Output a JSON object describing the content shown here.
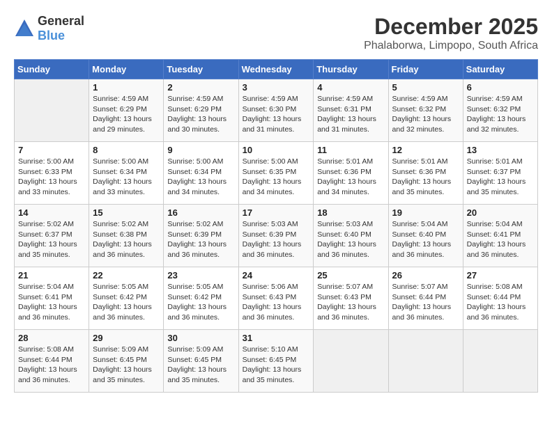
{
  "header": {
    "logo_general": "General",
    "logo_blue": "Blue",
    "month": "December 2025",
    "location": "Phalaborwa, Limpopo, South Africa"
  },
  "days_of_week": [
    "Sunday",
    "Monday",
    "Tuesday",
    "Wednesday",
    "Thursday",
    "Friday",
    "Saturday"
  ],
  "weeks": [
    [
      {
        "day": "",
        "info": ""
      },
      {
        "day": "1",
        "info": "Sunrise: 4:59 AM\nSunset: 6:29 PM\nDaylight: 13 hours\nand 29 minutes."
      },
      {
        "day": "2",
        "info": "Sunrise: 4:59 AM\nSunset: 6:29 PM\nDaylight: 13 hours\nand 30 minutes."
      },
      {
        "day": "3",
        "info": "Sunrise: 4:59 AM\nSunset: 6:30 PM\nDaylight: 13 hours\nand 31 minutes."
      },
      {
        "day": "4",
        "info": "Sunrise: 4:59 AM\nSunset: 6:31 PM\nDaylight: 13 hours\nand 31 minutes."
      },
      {
        "day": "5",
        "info": "Sunrise: 4:59 AM\nSunset: 6:32 PM\nDaylight: 13 hours\nand 32 minutes."
      },
      {
        "day": "6",
        "info": "Sunrise: 4:59 AM\nSunset: 6:32 PM\nDaylight: 13 hours\nand 32 minutes."
      }
    ],
    [
      {
        "day": "7",
        "info": "Sunrise: 5:00 AM\nSunset: 6:33 PM\nDaylight: 13 hours\nand 33 minutes."
      },
      {
        "day": "8",
        "info": "Sunrise: 5:00 AM\nSunset: 6:34 PM\nDaylight: 13 hours\nand 33 minutes."
      },
      {
        "day": "9",
        "info": "Sunrise: 5:00 AM\nSunset: 6:34 PM\nDaylight: 13 hours\nand 34 minutes."
      },
      {
        "day": "10",
        "info": "Sunrise: 5:00 AM\nSunset: 6:35 PM\nDaylight: 13 hours\nand 34 minutes."
      },
      {
        "day": "11",
        "info": "Sunrise: 5:01 AM\nSunset: 6:36 PM\nDaylight: 13 hours\nand 34 minutes."
      },
      {
        "day": "12",
        "info": "Sunrise: 5:01 AM\nSunset: 6:36 PM\nDaylight: 13 hours\nand 35 minutes."
      },
      {
        "day": "13",
        "info": "Sunrise: 5:01 AM\nSunset: 6:37 PM\nDaylight: 13 hours\nand 35 minutes."
      }
    ],
    [
      {
        "day": "14",
        "info": "Sunrise: 5:02 AM\nSunset: 6:37 PM\nDaylight: 13 hours\nand 35 minutes."
      },
      {
        "day": "15",
        "info": "Sunrise: 5:02 AM\nSunset: 6:38 PM\nDaylight: 13 hours\nand 36 minutes."
      },
      {
        "day": "16",
        "info": "Sunrise: 5:02 AM\nSunset: 6:39 PM\nDaylight: 13 hours\nand 36 minutes."
      },
      {
        "day": "17",
        "info": "Sunrise: 5:03 AM\nSunset: 6:39 PM\nDaylight: 13 hours\nand 36 minutes."
      },
      {
        "day": "18",
        "info": "Sunrise: 5:03 AM\nSunset: 6:40 PM\nDaylight: 13 hours\nand 36 minutes."
      },
      {
        "day": "19",
        "info": "Sunrise: 5:04 AM\nSunset: 6:40 PM\nDaylight: 13 hours\nand 36 minutes."
      },
      {
        "day": "20",
        "info": "Sunrise: 5:04 AM\nSunset: 6:41 PM\nDaylight: 13 hours\nand 36 minutes."
      }
    ],
    [
      {
        "day": "21",
        "info": "Sunrise: 5:04 AM\nSunset: 6:41 PM\nDaylight: 13 hours\nand 36 minutes."
      },
      {
        "day": "22",
        "info": "Sunrise: 5:05 AM\nSunset: 6:42 PM\nDaylight: 13 hours\nand 36 minutes."
      },
      {
        "day": "23",
        "info": "Sunrise: 5:05 AM\nSunset: 6:42 PM\nDaylight: 13 hours\nand 36 minutes."
      },
      {
        "day": "24",
        "info": "Sunrise: 5:06 AM\nSunset: 6:43 PM\nDaylight: 13 hours\nand 36 minutes."
      },
      {
        "day": "25",
        "info": "Sunrise: 5:07 AM\nSunset: 6:43 PM\nDaylight: 13 hours\nand 36 minutes."
      },
      {
        "day": "26",
        "info": "Sunrise: 5:07 AM\nSunset: 6:44 PM\nDaylight: 13 hours\nand 36 minutes."
      },
      {
        "day": "27",
        "info": "Sunrise: 5:08 AM\nSunset: 6:44 PM\nDaylight: 13 hours\nand 36 minutes."
      }
    ],
    [
      {
        "day": "28",
        "info": "Sunrise: 5:08 AM\nSunset: 6:44 PM\nDaylight: 13 hours\nand 36 minutes."
      },
      {
        "day": "29",
        "info": "Sunrise: 5:09 AM\nSunset: 6:45 PM\nDaylight: 13 hours\nand 35 minutes."
      },
      {
        "day": "30",
        "info": "Sunrise: 5:09 AM\nSunset: 6:45 PM\nDaylight: 13 hours\nand 35 minutes."
      },
      {
        "day": "31",
        "info": "Sunrise: 5:10 AM\nSunset: 6:45 PM\nDaylight: 13 hours\nand 35 minutes."
      },
      {
        "day": "",
        "info": ""
      },
      {
        "day": "",
        "info": ""
      },
      {
        "day": "",
        "info": ""
      }
    ]
  ]
}
